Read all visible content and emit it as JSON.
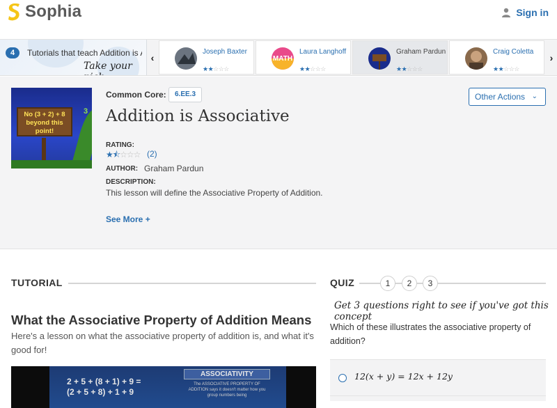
{
  "header": {
    "brand": "Sophia",
    "signin_label": "Sign in"
  },
  "carousel": {
    "count": "4",
    "intro": "Tutorials that teach Addition is Associative",
    "take_pick": "Take your pick:",
    "prev_icon": "chevron-left-icon",
    "next_icon": "chevron-right-icon",
    "tutorials": [
      {
        "name": "Joseph Baxter",
        "rating": 2
      },
      {
        "name": "Laura Langhoff",
        "rating": 2
      },
      {
        "name": "Graham Pardun",
        "rating": 2
      },
      {
        "name": "Craig Coletta",
        "rating": 2
      }
    ]
  },
  "lesson": {
    "thumbnail_text": "No (3 + 2) + 8 beyond this point!",
    "thumbnail_number": "3",
    "common_core_label": "Common Core:",
    "common_core_code": "6.EE.3",
    "title": "Addition is Associative",
    "other_actions": "Other Actions",
    "rating_label": "RATING:",
    "rating_value": 1.5,
    "rating_max": 5,
    "rating_count": "(2)",
    "author_label": "AUTHOR:",
    "author": "Graham Pardun",
    "description_label": "DESCRIPTION:",
    "description": "This lesson will define the Associative Property of Addition.",
    "see_more": "See More +"
  },
  "tutorial": {
    "section": "TUTORIAL",
    "title": "What the Associative Property of Addition Means",
    "description": "Here's a lesson on what the associative property of addition is, and what it's good for!",
    "video": {
      "eq_line1": "2 + 5 + (8 + 1) + 9 =",
      "eq_line2": "(2 + 5 + 8) + 1 + 9",
      "panel_title": "ASSOCIATIVITY",
      "panel_text": "The ASSOCIATIVE PROPERTY OF ADDITION says it doesn't matter how you group numbers being"
    }
  },
  "quiz": {
    "section": "QUIZ",
    "steps": [
      "1",
      "2",
      "3"
    ],
    "hint": "Get 3 questions right to see if you've got this concept",
    "question": "Which of these illustrates the associative property of addition?",
    "option_1": "12(x + y) = 12x + 12y"
  },
  "colors": {
    "brand_yellow": "#f5c518",
    "link_blue": "#2a6fb0"
  }
}
